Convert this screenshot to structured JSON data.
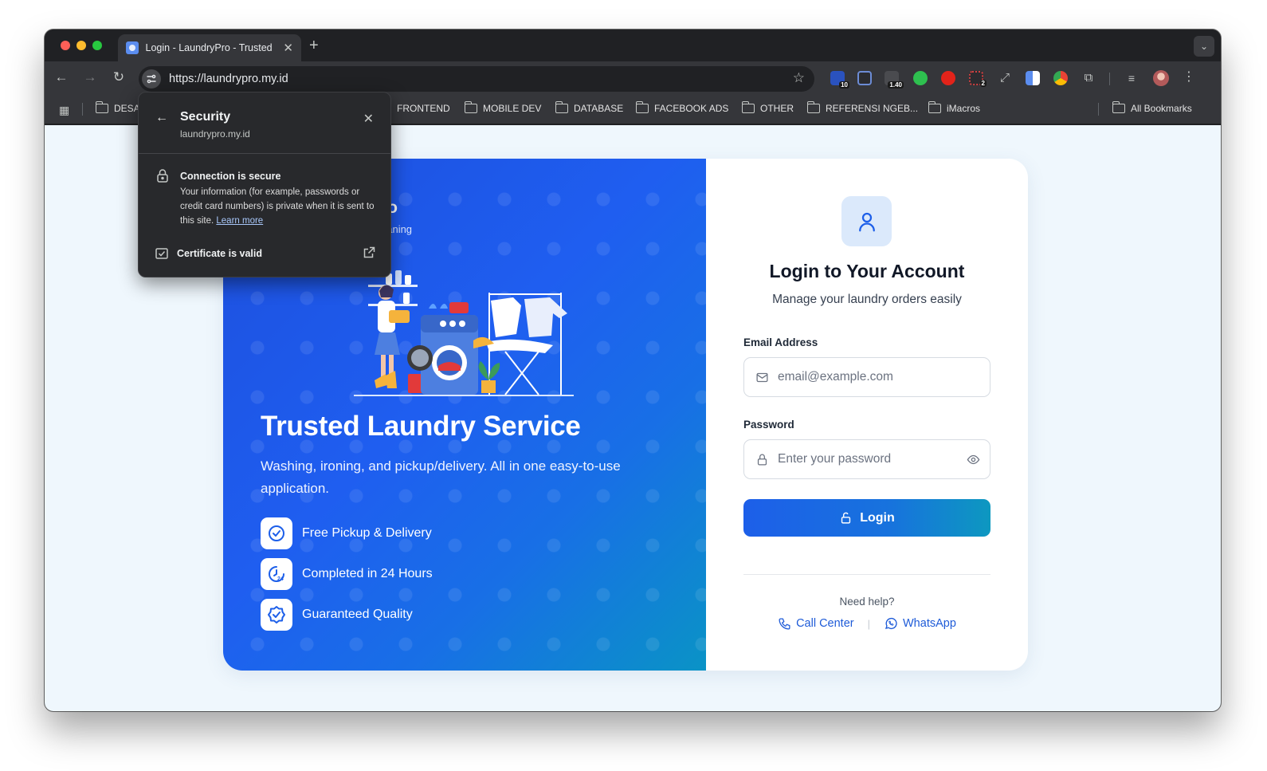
{
  "browser": {
    "tab_title": "Login - LaundryPro - Trusted",
    "url": "https://laundrypro.my.id",
    "extensions": [
      {
        "name": "extension-badge-10",
        "badge": "10",
        "color": "#2a52be"
      },
      {
        "name": "extension-eye",
        "badge": "",
        "color": "#6c8cd5"
      },
      {
        "name": "extension-badge-140",
        "badge": "1.40",
        "color": "#555555"
      },
      {
        "name": "extension-green-dot",
        "badge": "",
        "color": "#2ec04f"
      },
      {
        "name": "adblock-plus",
        "badge": "",
        "color": "#e2231a"
      },
      {
        "name": "extension-badge-2",
        "badge": "2",
        "color": "#d04040"
      }
    ],
    "bookmarks": [
      "DESA",
      "FRONTEND",
      "MOBILE DEV",
      "DATABASE",
      "FACEBOOK ADS",
      "OTHER",
      "REFERENSI NGEB...",
      "iMacros"
    ],
    "all_bookmarks": "All Bookmarks"
  },
  "security_popup": {
    "title": "Security",
    "domain": "laundrypro.my.id",
    "connection_title": "Connection is secure",
    "connection_desc": "Your information (for example, passwords or credit card numbers) is private when it is sent to this site.",
    "learn_more": "Learn more",
    "certificate": "Certificate is valid"
  },
  "hero": {
    "brand_name_visible": "ro",
    "brand_tagline_visible": "eaning",
    "title": "Trusted Laundry Service",
    "description": "Washing, ironing, and pickup/delivery. All in one easy-to-use application.",
    "features": [
      {
        "label": "Free Pickup & Delivery",
        "icon": "check-circle-icon"
      },
      {
        "label": "Completed in 24 Hours",
        "icon": "clock-24-icon"
      },
      {
        "label": "Guaranteed Quality",
        "icon": "badge-check-icon"
      }
    ]
  },
  "login": {
    "title": "Login to Your Account",
    "subtitle": "Manage your laundry orders easily",
    "email_label": "Email Address",
    "email_placeholder": "email@example.com",
    "password_label": "Password",
    "password_placeholder": "Enter your password",
    "login_button": "Login",
    "need_help": "Need help?",
    "call_center": "Call Center",
    "whatsapp": "WhatsApp"
  },
  "colors": {
    "primary": "#1d5fe9",
    "hero_gradient_start": "#1d4fdd",
    "hero_gradient_end": "#0a93c6",
    "page_background": "#eff7fd"
  }
}
